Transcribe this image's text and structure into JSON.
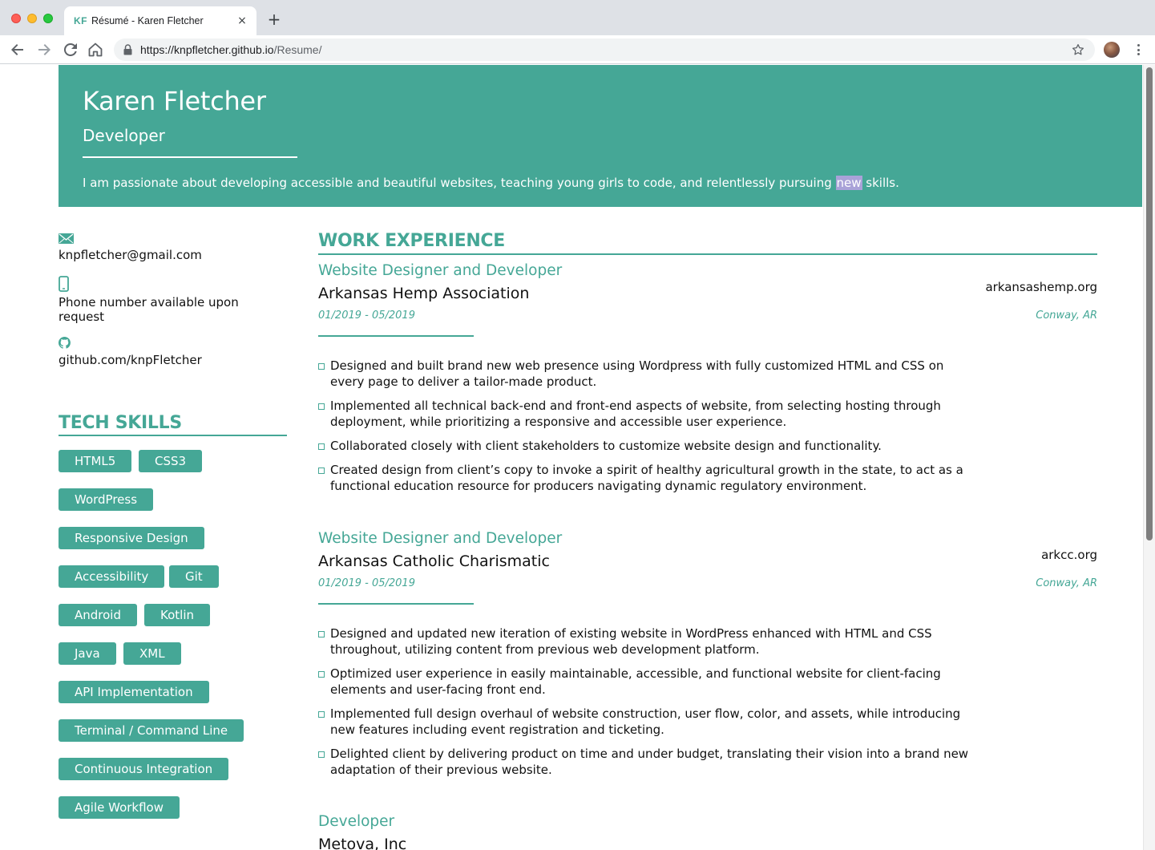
{
  "browser": {
    "tab_favicon": "KF",
    "tab_title": "Résumé - Karen Fletcher",
    "tab_close": "×",
    "new_tab": "+",
    "url_scheme": "https://",
    "url_host": "knpfletcher.github.io",
    "url_path": "/Resume/",
    "icons": [
      "back-arrow-icon",
      "forward-arrow-icon",
      "reload-icon",
      "home-icon",
      "lock-icon",
      "star-icon",
      "avatar",
      "kebab-menu-icon"
    ]
  },
  "hero": {
    "name": "Karen Fletcher",
    "role": "Developer",
    "bio_before": "I am passionate about developing accessible and beautiful websites, teaching young girls to code, and relentlessly pursuing ",
    "bio_highlight": "new",
    "bio_after": " skills."
  },
  "contact": {
    "email": "knpfletcher@gmail.com",
    "phone": "Phone number available upon request",
    "github": "github.com/knpFletcher"
  },
  "skills": {
    "title": "TECH SKILLS",
    "items": [
      "HTML5",
      "CSS3",
      "WordPress",
      "Responsive Design",
      "Accessibility",
      "Git",
      "Android",
      "Kotlin",
      "Java",
      "XML",
      "API Implementation",
      "Terminal / Command Line",
      "Continuous Integration",
      "Agile Workflow"
    ]
  },
  "work": {
    "title": "WORK EXPERIENCE",
    "jobs": [
      {
        "title": "Website Designer and Developer",
        "org": "Arkansas Hemp Association",
        "site": "arkansashemp.org",
        "dates": "01/2019 - 05/2019",
        "location": "Conway, AR",
        "bullets": [
          "Designed and built brand new web presence using Wordpress with fully customized HTML and CSS on every page to deliver a tailor-made product.",
          "Implemented all technical back-end and front-end aspects of website, from selecting hosting through deployment, while prioritizing a responsive and accessible user experience.",
          "Collaborated closely with client stakeholders to customize website design and functionality.",
          "Created design from client’s copy to invoke a spirit of healthy agricultural growth in the state, to act as a functional education resource for producers navigating dynamic regulatory environment."
        ]
      },
      {
        "title": "Website Designer and Developer",
        "org": "Arkansas Catholic Charismatic",
        "site": "arkcc.org",
        "dates": "01/2019 - 05/2019",
        "location": "Conway, AR",
        "bullets": [
          "Designed and updated new iteration of existing website in WordPress enhanced with HTML and CSS throughout, utilizing content from previous web development platform.",
          "Optimized user experience in easily maintainable, accessible, and functional website for client-facing elements and user-facing front end.",
          "Implemented full design overhaul of website construction, user flow, color, and assets, while introducing new features including event registration and ticketing.",
          "Delighted client by delivering product on time and under budget, translating their vision into a brand new adaptation of their previous website."
        ]
      },
      {
        "title": "Developer",
        "org": "Metova, Inc"
      }
    ]
  },
  "colors": {
    "accent": "#45a796",
    "highlight": "#a9a2d8",
    "tabbar": "#dee1e6"
  }
}
